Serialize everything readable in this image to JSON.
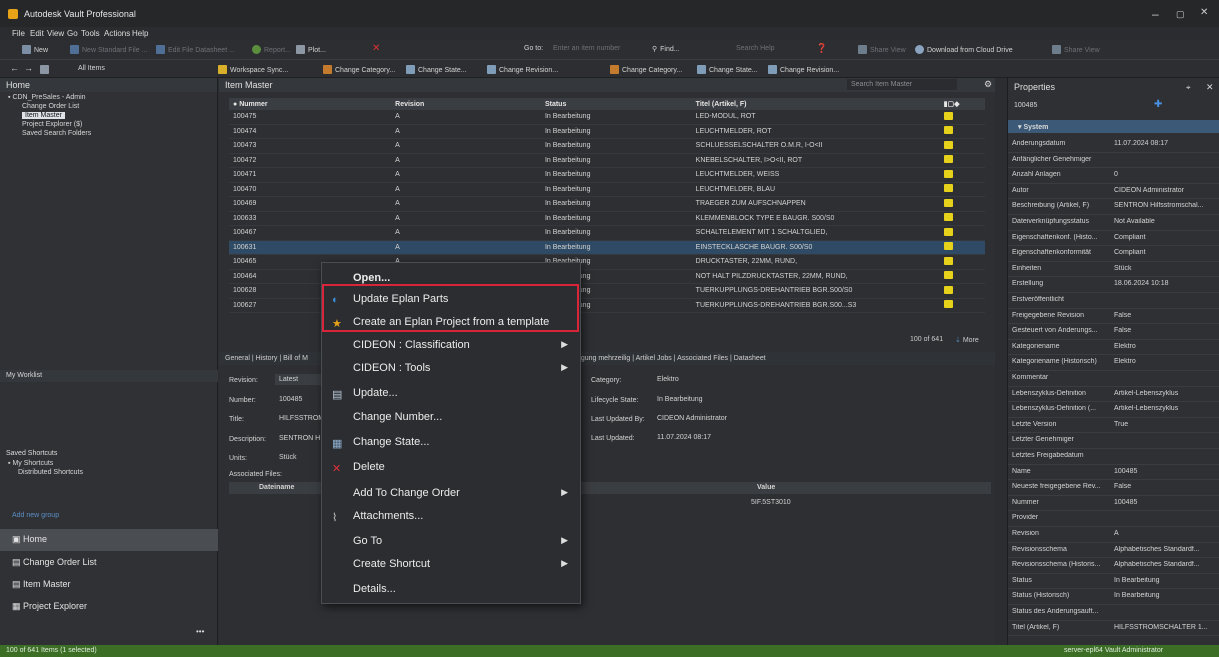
{
  "window": {
    "title": "Autodesk Vault Professional",
    "minimize": "–",
    "maximize": "▢",
    "close": "✕"
  },
  "menu": [
    "File",
    "Edit",
    "View",
    "Go",
    "Tools",
    "Actions",
    "Help"
  ],
  "toolbar1": {
    "new": "New",
    "new_std_file": "New Standard File ...",
    "edit_datasheet": "Edit File Datasheet ...",
    "report": "Report...",
    "plot": "Plot...",
    "goto": "Go to:",
    "goto_placeholder": "Enter an item number",
    "find": "Find...",
    "search_help": "Search Help",
    "share_view": "Share View",
    "download_cloud": "Download from Cloud Drive",
    "share_view2": "Share View"
  },
  "toolbar2": {
    "all_items": "All Items",
    "workspace_sync": "Workspace Sync...",
    "change_category": "Change Category...",
    "change_state": "Change State...",
    "change_revision": "Change Revision...",
    "change_category2": "Change Category...",
    "change_state2": "Change State...",
    "change_revision2": "Change Revision..."
  },
  "left": {
    "header": "Home",
    "tree": [
      "CDN_PreSales - Admin",
      "Change Order List",
      "Item Master",
      "Project Explorer ($)",
      "Saved Search Folders"
    ],
    "worklist": "My Worklist",
    "saved_shortcuts": "Saved Shortcuts",
    "shortcuts": [
      "My Shortcuts",
      "Distributed Shortcuts"
    ],
    "add_group": "Add new group",
    "nav": [
      "Home",
      "Change Order List",
      "Item Master",
      "Project Explorer"
    ],
    "more": "•••"
  },
  "center": {
    "title": "Item Master",
    "search_placeholder": "Search Item Master",
    "columns": [
      "Nummer",
      "Revision",
      "Status",
      "Titel (Artikel, F)"
    ],
    "rows": [
      [
        "100475",
        "A",
        "In Bearbeitung",
        "LED-MODUL, ROT"
      ],
      [
        "100474",
        "A",
        "In Bearbeitung",
        "LEUCHTMELDER, ROT"
      ],
      [
        "100473",
        "A",
        "In Bearbeitung",
        "SCHLUESSELSCHALTER O.M.R, I-O<II"
      ],
      [
        "100472",
        "A",
        "In Bearbeitung",
        "KNEBELSCHALTER, I>O<II, ROT"
      ],
      [
        "100471",
        "A",
        "In Bearbeitung",
        "LEUCHTMELDER, WEISS"
      ],
      [
        "100470",
        "A",
        "In Bearbeitung",
        "LEUCHTMELDER, BLAU"
      ],
      [
        "100469",
        "A",
        "In Bearbeitung",
        "TRAEGER ZUM AUFSCHNAPPEN"
      ],
      [
        "100633",
        "A",
        "In Bearbeitung",
        "KLEMMENBLOCK TYPE E BAUGR. S00/S0"
      ],
      [
        "100467",
        "A",
        "In Bearbeitung",
        "SCHALTELEMENT MIT 1 SCHALTGLIED,"
      ],
      [
        "100631",
        "A",
        "In Bearbeitung",
        "EINSTECKLASCHE BAUGR. S00/S0"
      ],
      [
        "100465",
        "A",
        "In Bearbeitung",
        "DRUCKTASTER, 22MM, RUND,"
      ],
      [
        "100464",
        "A",
        "In Bearbeitung",
        "NOT HALT PILZDRUCKTASTER, 22MM, RUND,"
      ],
      [
        "100628",
        "A",
        "In Bearbeitung",
        "TUERKUPPLUNGS-DREHANTRIEB BGR.S00/S0"
      ],
      [
        "100627",
        "A",
        "In Bearbeitung",
        "TUERKUPPLUNGS-DREHANTRIEB BGR.S00...S3"
      ]
    ],
    "count": "100 of 641",
    "more": "More",
    "tabs": "General | History | Bill of M",
    "tabs2": "rtigung mehrzeilig | Artikel Jobs | Associated Files | Datasheet",
    "detail": {
      "revision_label": "Revision:",
      "revision_value": "Latest",
      "number_label": "Number:",
      "number_value": "100485",
      "title_label": "Title:",
      "title_value": "HILFSSTROM",
      "desc_label": "Description:",
      "desc_value": "SENTRON H",
      "units_label": "Units:",
      "units_value": "Stück",
      "assoc_label": "Associated Files:",
      "file_col": "Dateiname",
      "category_label": "Category:",
      "category_value": "Elektro",
      "lifecycle_label": "Lifecycle State:",
      "lifecycle_value": "In Bearbeitung",
      "updated_by_label": "Last Updated By:",
      "updated_by_value": "CIDEON Administrator",
      "updated_label": "Last Updated:",
      "updated_value": "11.07.2024 08:17",
      "value_col": "Value",
      "value_cell": "5IF.5ST3010"
    }
  },
  "context_menu": [
    {
      "label": "Open...",
      "bold": true
    },
    {
      "label": "Update Eplan Parts",
      "icon": "eplan-update-icon"
    },
    {
      "label": "Create an Eplan Project from a template",
      "icon": "eplan-project-icon"
    },
    {
      "label": "CIDEON : Classification",
      "submenu": true
    },
    {
      "label": "CIDEON : Tools",
      "submenu": true
    },
    {
      "label": "Update...",
      "icon": "update-icon"
    },
    {
      "label": "Change Number..."
    },
    {
      "label": "Change State...",
      "icon": "change-state-icon"
    },
    {
      "label": "Delete",
      "icon": "delete-icon"
    },
    {
      "label": "Add To Change Order",
      "submenu": true
    },
    {
      "label": "Attachments...",
      "icon": "paperclip-icon"
    },
    {
      "label": "Go To",
      "submenu": true
    },
    {
      "label": "Create Shortcut",
      "submenu": true
    },
    {
      "label": "Details..."
    }
  ],
  "properties": {
    "header": "Properties",
    "item": "100485",
    "group": "System",
    "rows": [
      [
        "Änderungsdatum",
        "11.07.2024 08:17"
      ],
      [
        "Anfänglicher Genehmiger",
        ""
      ],
      [
        "Anzahl Anlagen",
        "0"
      ],
      [
        "Autor",
        "CIDEON Administrator"
      ],
      [
        "Beschreibung (Artikel, F)",
        "SENTRON Hilfsstromschal..."
      ],
      [
        "Dateiverknüpfungsstatus",
        "Not Available"
      ],
      [
        "Eigenschaftenkonf. (Histo...",
        "Compliant"
      ],
      [
        "Eigenschaftenkonformität",
        "Compliant"
      ],
      [
        "Einheiten",
        "Stück"
      ],
      [
        "Erstellung",
        "18.06.2024 10:18"
      ],
      [
        "Erstveröffentlicht",
        ""
      ],
      [
        "Freigegebene Revision",
        "False"
      ],
      [
        "Gesteuert von Änderungs...",
        "False"
      ],
      [
        "Kategoriename",
        "Elektro"
      ],
      [
        "Kategoriename (Historisch)",
        "Elektro"
      ],
      [
        "Kommentar",
        ""
      ],
      [
        "Lebenszyklus-Definition",
        "Artikel-Lebenszyklus"
      ],
      [
        "Lebenszyklus-Definition (...",
        "Artikel-Lebenszyklus"
      ],
      [
        "Letzte Version",
        "True"
      ],
      [
        "Letzter Genehmiger",
        ""
      ],
      [
        "Letztes Freigabedatum",
        ""
      ],
      [
        "Name",
        "100485"
      ],
      [
        "Neueste freigegebene Rev...",
        "False"
      ],
      [
        "Nummer",
        "100485"
      ],
      [
        "Provider",
        ""
      ],
      [
        "Revision",
        "A"
      ],
      [
        "Revisionsschema",
        "Alphabetisches Standardf..."
      ],
      [
        "Revisionsschema (Historis...",
        "Alphabetisches Standardf..."
      ],
      [
        "Status",
        "In Bearbeitung"
      ],
      [
        "Status (Historisch)",
        "In Bearbeitung"
      ],
      [
        "Status des Änderungsauft...",
        ""
      ],
      [
        "Titel (Artikel, F)",
        "HILFSSTROMSCHALTER 1..."
      ]
    ]
  },
  "statusbar": {
    "left": "100 of 641 Items (1 selected)",
    "right": "server-epl64  Vault  Administrator"
  },
  "colors": {
    "accent_green": "#3c6e26",
    "status_yellow": "#e6d21a",
    "highlight_red": "#d9253a"
  }
}
